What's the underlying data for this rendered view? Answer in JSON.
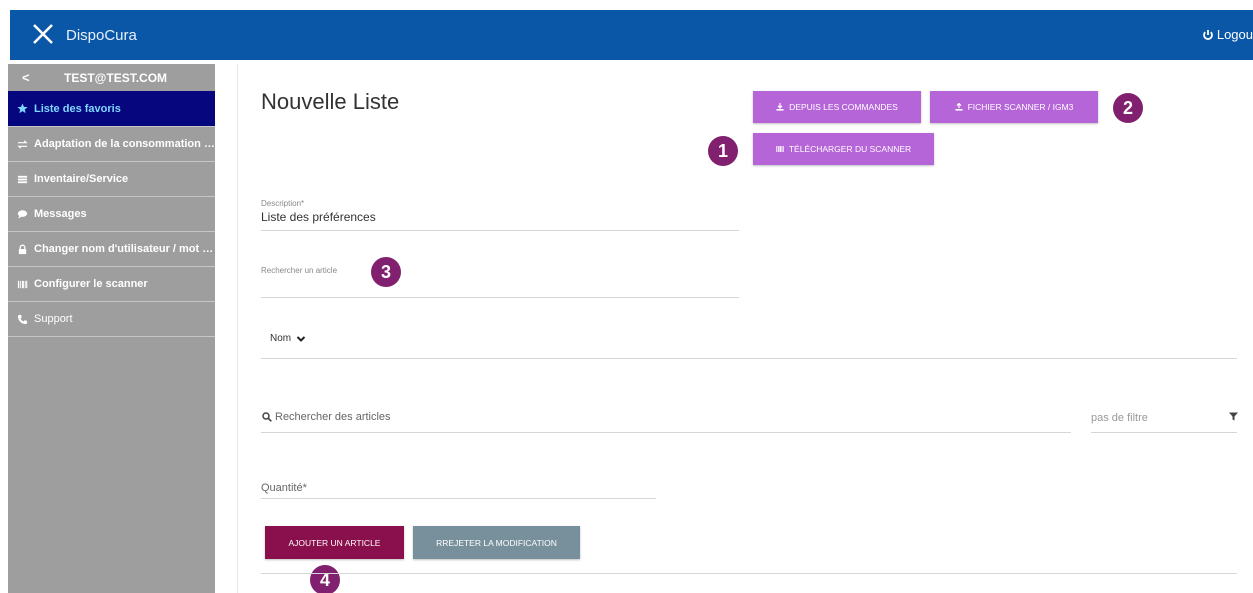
{
  "app": {
    "brand": "DispoCura",
    "logout_label": "Logou"
  },
  "sidebar": {
    "back": "<",
    "user_email": "TEST@TEST.COM",
    "items": [
      {
        "label": "Liste des favoris",
        "icon": "star-icon",
        "active": true
      },
      {
        "label": "Adaptation de la consommation q...",
        "icon": "swap-icon"
      },
      {
        "label": "Inventaire/Service",
        "icon": "list-icon"
      },
      {
        "label": "Messages",
        "icon": "chat-icon"
      },
      {
        "label": "Changer nom d'utilisateur / mot de...",
        "icon": "lock-icon"
      },
      {
        "label": "Configurer le scanner",
        "icon": "barcode-icon"
      },
      {
        "label": "Support",
        "icon": "phone-icon"
      }
    ]
  },
  "main": {
    "title": "Nouvelle Liste",
    "buttons": {
      "from_orders": "DEPUIS LES COMMANDES",
      "scanner_file": "FICHIER SCANNER / IGM3",
      "download_scanner": "TÉLÉCHARGER DU SCANNER",
      "add_article": "AJOUTER UN ARTICLE",
      "reject": "RREJETER LA MODIFICATION"
    },
    "description": {
      "label": "Description*",
      "value": "Liste des préférences"
    },
    "search_article": {
      "label": "Rechercher un article"
    },
    "sort": {
      "label": "Nom"
    },
    "search_articles": {
      "placeholder": "Rechercher des articles"
    },
    "filter": {
      "value": "pas de filtre"
    },
    "quantity": {
      "label": "Quantité*"
    }
  },
  "badges": [
    "1",
    "2",
    "3",
    "4"
  ],
  "colors": {
    "header": "#0a57a8",
    "sidebar": "#9e9e9e",
    "sidebar_active": "#06067e",
    "button_purple": "#b565d8",
    "button_maroon": "#8a0f4d",
    "button_gray": "#78909c",
    "badge": "#80206e"
  }
}
